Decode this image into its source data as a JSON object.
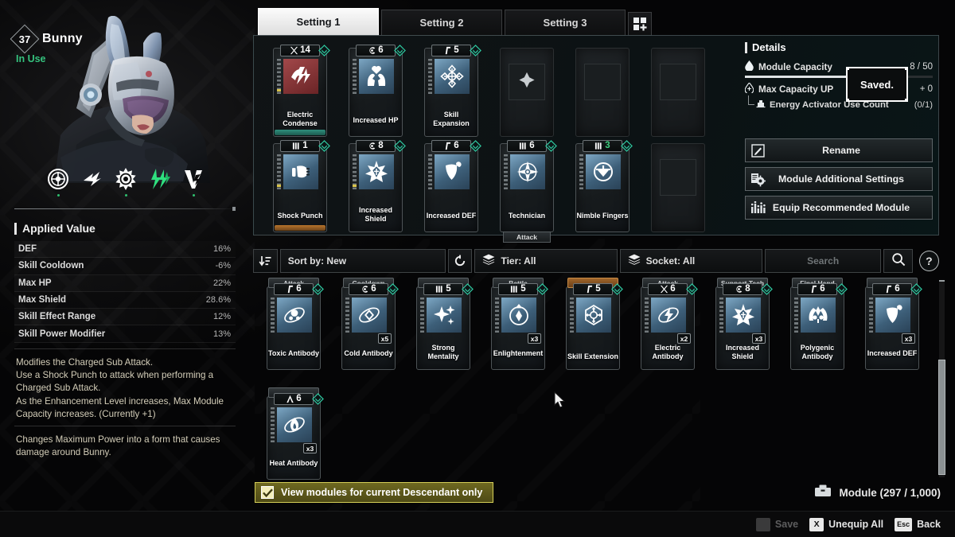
{
  "character": {
    "level": "37",
    "name": "Bunny",
    "status": "In Use"
  },
  "applied_value": {
    "title": "Applied Value",
    "stats": [
      {
        "name": "DEF",
        "value": "16%"
      },
      {
        "name": "Skill Cooldown",
        "value": "-6%"
      },
      {
        "name": "Max HP",
        "value": "22%"
      },
      {
        "name": "Max Shield",
        "value": "28.6%"
      },
      {
        "name": "Skill Effect Range",
        "value": "12%"
      },
      {
        "name": "Skill Power Modifier",
        "value": "13%"
      }
    ],
    "description_1": "Modifies the Charged Sub Attack.\nUse a Shock Punch to attack when performing a Charged Sub Attack.\nAs the Enhancement Level increases, Max Module Capacity increases. (Currently +1)",
    "description_2": "Changes Maximum Power into a form that causes damage around Bunny."
  },
  "tabs": {
    "items": [
      {
        "label": "Setting 1",
        "active": true
      },
      {
        "label": "Setting 2",
        "active": false
      },
      {
        "label": "Setting 3",
        "active": false
      }
    ],
    "add_label": "+"
  },
  "equipped_modules": [
    {
      "name": "Electric Condense",
      "cost": "14",
      "socket": "bowtie",
      "icon": "electric-beast",
      "tier": "gem",
      "icon_color": "red",
      "filled": 9,
      "lit": true,
      "foot": "teal"
    },
    {
      "name": "Increased HP",
      "cost": "6",
      "socket": "cerulean",
      "icon": "hands-heart",
      "tier": "gem",
      "filled": 8,
      "foot": "none"
    },
    {
      "name": "Skill Expansion",
      "cost": "5",
      "socket": "rho",
      "icon": "expand-cross",
      "tier": "gem",
      "filled": 8,
      "foot": "none"
    },
    {
      "name": "",
      "cost": "",
      "socket": "",
      "icon": "empty-x",
      "empty": true
    },
    {
      "name": "",
      "cost": "",
      "socket": "",
      "icon": "empty",
      "empty": true
    },
    {
      "name": "",
      "cost": "",
      "socket": "",
      "icon": "empty",
      "empty": true
    },
    {
      "name": "Shock Punch",
      "cost": "1",
      "socket": "malachite",
      "icon": "fist",
      "tier": "gem",
      "filled": 7,
      "lit": true,
      "foot": "orange"
    },
    {
      "name": "Increased Shield",
      "cost": "8",
      "socket": "cerulean",
      "icon": "shield-star",
      "tier": "gem",
      "filled": 7,
      "lit": true,
      "foot": "none"
    },
    {
      "name": "Increased DEF",
      "cost": "6",
      "socket": "rho",
      "icon": "shield-plain",
      "tier": "gem",
      "filled": 7,
      "foot": "none"
    },
    {
      "name": "Technician",
      "cost": "6",
      "socket": "malachite",
      "icon": "compass-star",
      "tier": "gem",
      "filled": 8,
      "foot": "none",
      "sub_tag": "Attack"
    },
    {
      "name": "Nimble Fingers",
      "cost": "3",
      "socket": "malachite",
      "icon": "reload-arrow",
      "tier": "gem",
      "cost_green": true,
      "filled": 8,
      "foot": "none"
    },
    {
      "name": "",
      "cost": "",
      "socket": "",
      "icon": "empty",
      "empty": true
    }
  ],
  "details": {
    "title": "Details",
    "module_capacity": {
      "label": "Module Capacity",
      "value": "8 / 50",
      "fill_pct": 76
    },
    "max_capacity_up": {
      "label": "Max Capacity UP",
      "value": "+ 0"
    },
    "energy_activator": {
      "label": "Energy Activator Use Count",
      "value": "(0/1)"
    },
    "saved_toast": "Saved.",
    "buttons": [
      {
        "label": "Rename",
        "icon": "pencil-icon"
      },
      {
        "label": "Module Additional Settings",
        "icon": "settings-gear-icon"
      },
      {
        "label": "Equip Recommended Module",
        "icon": "bar-chart-icon"
      }
    ]
  },
  "filter_bar": {
    "sort_label": "Sort by: New",
    "tier_label": "Tier: All",
    "socket_label": "Socket: All",
    "search_placeholder": "Search",
    "search_value": "",
    "help_label": "?"
  },
  "inventory": [
    {
      "name": "Toxic Antibody",
      "cost": "6",
      "socket": "rho",
      "icon": "toxic-orbit",
      "category": "Attack",
      "filled": 9,
      "qty": ""
    },
    {
      "name": "Cold Antibody",
      "cost": "6",
      "socket": "cerulean",
      "icon": "cold-orbit",
      "category": "Cooldown",
      "filled": 9,
      "qty": "x5"
    },
    {
      "name": "Strong Mentality",
      "cost": "5",
      "socket": "malachite",
      "icon": "sparkle",
      "category": "",
      "filled": 5,
      "qty": ""
    },
    {
      "name": "Enlightenment",
      "cost": "5",
      "socket": "malachite",
      "icon": "arrow-diamond",
      "category": "Battle",
      "filled": 5,
      "qty": "x3"
    },
    {
      "name": "Skill Extension",
      "cost": "5",
      "socket": "rho",
      "icon": "expand-hex",
      "category": "",
      "category_orange": true,
      "filled": 9,
      "qty": ""
    },
    {
      "name": "Electric Antibody",
      "cost": "6",
      "socket": "bowtie",
      "icon": "electric-orbit",
      "category": "Attack",
      "filled": 9,
      "qty": "x2"
    },
    {
      "name": "Increased Shield",
      "cost": "8",
      "socket": "cerulean",
      "icon": "shield-star",
      "category": "Support Tech",
      "filled": 9,
      "qty": "x3"
    },
    {
      "name": "Polygenic Antibody",
      "cost": "6",
      "socket": "rho",
      "icon": "poly-orbit",
      "category": "Final Hand",
      "filled": 9,
      "qty": ""
    },
    {
      "name": "Increased DEF",
      "cost": "6",
      "socket": "rho",
      "icon": "shield-plain",
      "category": "",
      "filled": 9,
      "qty": "x3"
    },
    {
      "name": "Heat Antibody",
      "cost": "6",
      "socket": "almandine",
      "icon": "heat-orbit",
      "category": "",
      "filled": 9,
      "qty": "x3"
    }
  ],
  "bottom": {
    "view_only_label": "View modules for current Descendant only",
    "view_only_checked": true,
    "module_count_label": "Module (297 / 1,000)"
  },
  "footer": {
    "items": [
      {
        "key": "",
        "label": "Save",
        "dim": true
      },
      {
        "key": "X",
        "label": "Unequip All",
        "dim": false
      },
      {
        "key": "Esc",
        "label": "Back",
        "dim": false
      }
    ]
  },
  "colors": {
    "accent_green": "#35c27e",
    "accent_yellow": "#d5cf58",
    "accent_orange": "#b7742c",
    "tier_gem": "#2fc9a0"
  }
}
